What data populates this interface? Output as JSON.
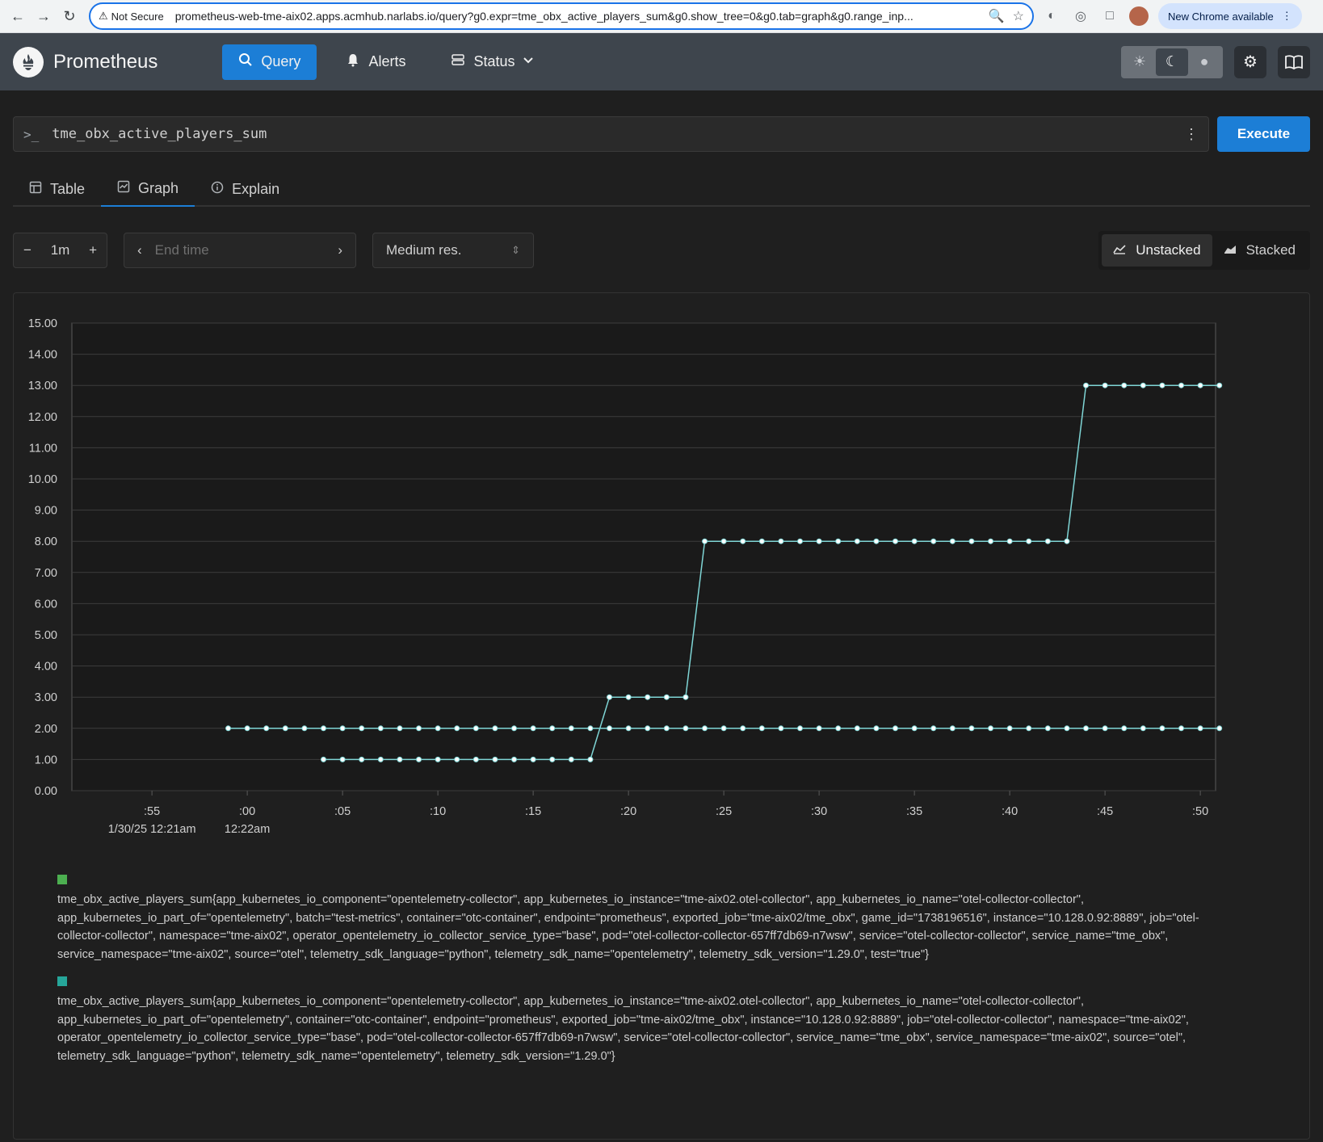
{
  "browser": {
    "security_label": "Not Secure",
    "url": "prometheus-web-tme-aix02.apps.acmhub.narlabs.io/query?g0.expr=tme_obx_active_players_sum&g0.show_tree=0&g0.tab=graph&g0.range_inp...",
    "update_label": "New Chrome available"
  },
  "header": {
    "brand": "Prometheus",
    "nav": {
      "query": "Query",
      "alerts": "Alerts",
      "status": "Status"
    }
  },
  "query": {
    "expression": "tme_obx_active_players_sum",
    "execute_label": "Execute"
  },
  "tabs": {
    "table": "Table",
    "graph": "Graph",
    "explain": "Explain"
  },
  "controls": {
    "range": "1m",
    "end_time_placeholder": "End time",
    "resolution": "Medium res.",
    "unstacked": "Unstacked",
    "stacked": "Stacked"
  },
  "colors": {
    "series1": "#4caf50",
    "series2": "#26a69a",
    "line": "#7fd6d6",
    "accent": "#1c7ed6"
  },
  "chart_data": {
    "type": "line",
    "y_ticks": [
      "0.00",
      "1.00",
      "2.00",
      "3.00",
      "4.00",
      "5.00",
      "6.00",
      "7.00",
      "8.00",
      "9.00",
      "10.00",
      "11.00",
      "12.00",
      "13.00",
      "14.00",
      "15.00"
    ],
    "ylim": [
      0,
      15
    ],
    "x_ticks": [
      ":55",
      ":00",
      ":05",
      ":10",
      ":15",
      ":20",
      ":25",
      ":30",
      ":35",
      ":40",
      ":45",
      ":50"
    ],
    "x_tick_seconds": [
      55,
      60,
      65,
      70,
      75,
      80,
      85,
      90,
      95,
      100,
      105,
      110
    ],
    "x_sublabels": [
      {
        "under": ":55",
        "text": "1/30/25 12:21am"
      },
      {
        "under": ":00",
        "text": "12:22am"
      }
    ],
    "xlim_seconds": [
      50.8,
      110.8
    ],
    "grid": true,
    "series": [
      {
        "start_second": 59,
        "end_second": 111,
        "values": [
          2,
          2,
          2,
          2,
          2,
          2,
          2,
          2,
          2,
          2,
          2,
          2,
          2,
          2,
          2,
          2,
          2,
          2,
          2,
          2,
          2,
          2,
          2,
          2,
          2,
          2,
          2,
          2,
          2,
          2,
          2,
          2,
          2,
          2,
          2,
          2,
          2,
          2,
          2,
          2,
          2,
          2,
          2,
          2,
          2,
          2,
          2,
          2,
          2,
          2,
          2,
          2,
          2
        ]
      },
      {
        "start_second": 64,
        "end_second": 111,
        "values": [
          1,
          1,
          1,
          1,
          1,
          1,
          1,
          1,
          1,
          1,
          1,
          1,
          1,
          1,
          1,
          3,
          3,
          3,
          3,
          3,
          8,
          8,
          8,
          8,
          8,
          8,
          8,
          8,
          8,
          8,
          8,
          8,
          8,
          8,
          8,
          8,
          8,
          8,
          8,
          8,
          13,
          13,
          13,
          13,
          13,
          13,
          13,
          13
        ]
      }
    ]
  },
  "legend": [
    {
      "swatch": "#4caf50",
      "text": "tme_obx_active_players_sum{app_kubernetes_io_component=\"opentelemetry-collector\", app_kubernetes_io_instance=\"tme-aix02.otel-collector\", app_kubernetes_io_name=\"otel-collector-collector\", app_kubernetes_io_part_of=\"opentelemetry\", batch=\"test-metrics\", container=\"otc-container\", endpoint=\"prometheus\", exported_job=\"tme-aix02/tme_obx\", game_id=\"1738196516\", instance=\"10.128.0.92:8889\", job=\"otel-collector-collector\", namespace=\"tme-aix02\", operator_opentelemetry_io_collector_service_type=\"base\", pod=\"otel-collector-collector-657ff7db69-n7wsw\", service=\"otel-collector-collector\", service_name=\"tme_obx\", service_namespace=\"tme-aix02\", source=\"otel\", telemetry_sdk_language=\"python\", telemetry_sdk_name=\"opentelemetry\", telemetry_sdk_version=\"1.29.0\", test=\"true\"}"
    },
    {
      "swatch": "#26a69a",
      "text": "tme_obx_active_players_sum{app_kubernetes_io_component=\"opentelemetry-collector\", app_kubernetes_io_instance=\"tme-aix02.otel-collector\", app_kubernetes_io_name=\"otel-collector-collector\", app_kubernetes_io_part_of=\"opentelemetry\", container=\"otc-container\", endpoint=\"prometheus\", exported_job=\"tme-aix02/tme_obx\", instance=\"10.128.0.92:8889\", job=\"otel-collector-collector\", namespace=\"tme-aix02\", operator_opentelemetry_io_collector_service_type=\"base\", pod=\"otel-collector-collector-657ff7db69-n7wsw\", service=\"otel-collector-collector\", service_name=\"tme_obx\", service_namespace=\"tme-aix02\", source=\"otel\", telemetry_sdk_language=\"python\", telemetry_sdk_name=\"opentelemetry\", telemetry_sdk_version=\"1.29.0\"}"
    }
  ]
}
